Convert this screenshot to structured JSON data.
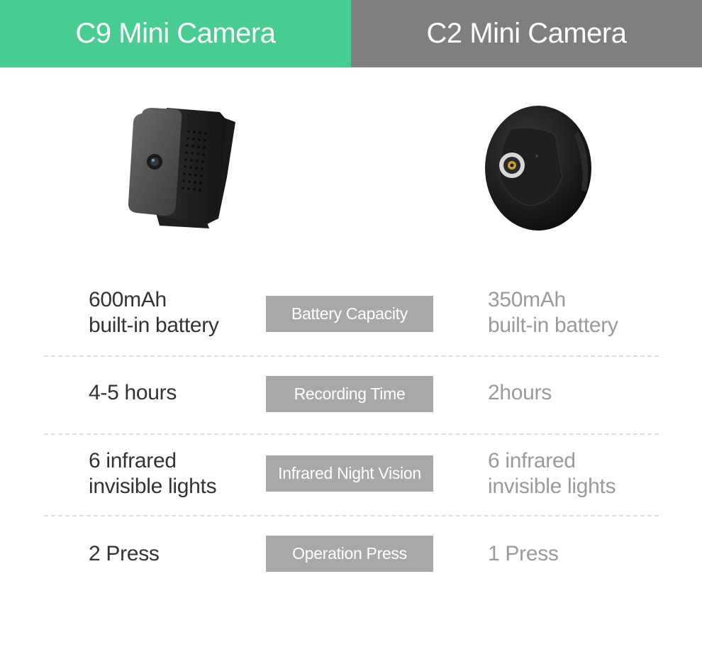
{
  "header": {
    "left_title": "C9 Mini Camera",
    "right_title": "C2 Mini Camera",
    "left_color": "#49cc92",
    "right_color": "#7f7f7f"
  },
  "products": {
    "left_image": "c9-mini-camera-image",
    "right_image": "c2-mini-camera-image"
  },
  "specs": [
    {
      "label": "Battery Capacity",
      "left_line1": "600mAh",
      "left_line2": "built-in battery",
      "right_line1": "350mAh",
      "right_line2": "built-in battery"
    },
    {
      "label": "Recording Time",
      "left_line1": "4-5 hours",
      "left_line2": "",
      "right_line1": "2hours",
      "right_line2": ""
    },
    {
      "label": "Infrared Night Vision",
      "left_line1": "6 infrared",
      "left_line2": "invisible lights",
      "right_line1": "6 infrared",
      "right_line2": "invisible lights"
    },
    {
      "label": "Operation Press",
      "left_line1": "2 Press",
      "left_line2": "",
      "right_line1": "1 Press",
      "right_line2": ""
    }
  ]
}
